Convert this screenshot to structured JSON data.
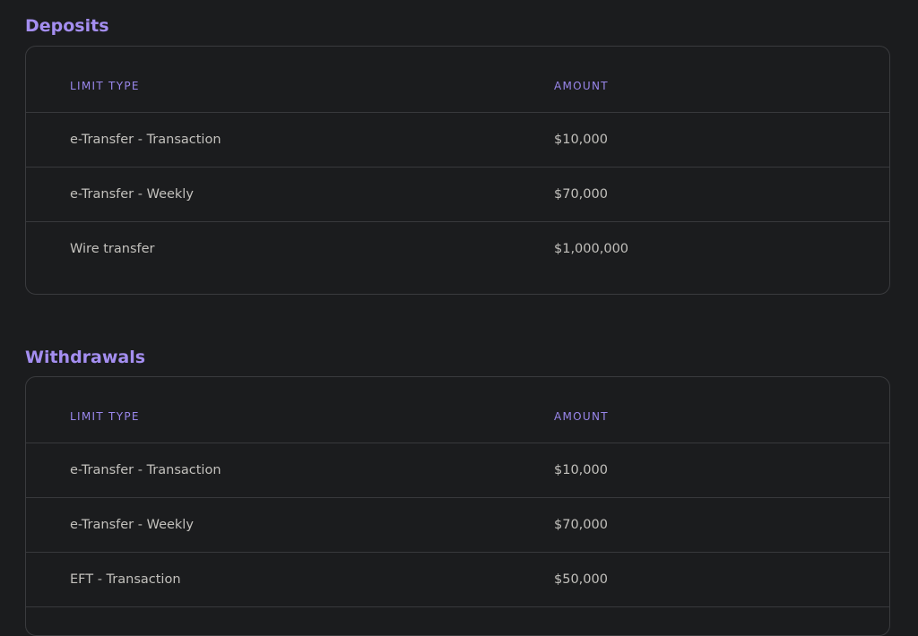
{
  "deposits": {
    "title": "Deposits",
    "headers": {
      "limit_type": "LIMIT TYPE",
      "amount": "AMOUNT"
    },
    "rows": [
      {
        "type": "e-Transfer - Transaction",
        "amount": "$10,000"
      },
      {
        "type": "e-Transfer - Weekly",
        "amount": "$70,000"
      },
      {
        "type": "Wire transfer",
        "amount": "$1,000,000"
      }
    ]
  },
  "withdrawals": {
    "title": "Withdrawals",
    "headers": {
      "limit_type": "LIMIT TYPE",
      "amount": "AMOUNT"
    },
    "rows": [
      {
        "type": "e-Transfer - Transaction",
        "amount": "$10,000"
      },
      {
        "type": "e-Transfer - Weekly",
        "amount": "$70,000"
      },
      {
        "type": "EFT - Transaction",
        "amount": "$50,000"
      }
    ]
  },
  "colors": {
    "background": "#1b1c1e",
    "accent": "#a48ef0",
    "text": "#c2c0bc",
    "border": "#3a3b3e"
  }
}
